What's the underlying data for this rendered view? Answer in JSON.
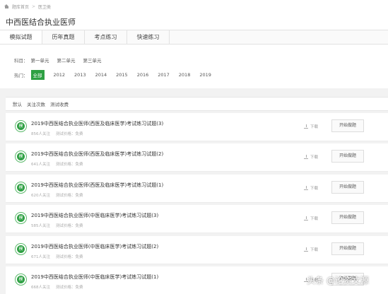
{
  "breadcrumb": {
    "home": "题库首页",
    "sep": ">",
    "current": "医卫类"
  },
  "page_title": "中西医结合执业医师",
  "tabs": [
    {
      "label": "模拟试题",
      "active": true
    },
    {
      "label": "历年真题",
      "active": false
    },
    {
      "label": "考点练习",
      "active": false
    },
    {
      "label": "快速练习",
      "active": false
    }
  ],
  "filters": {
    "subject_label": "科目：",
    "subjects": [
      "第一单元",
      "第二单元",
      "第三单元"
    ],
    "hot_label": "热门：",
    "hot": [
      "全部",
      "2012",
      "2013",
      "2014",
      "2015",
      "2016",
      "2017",
      "2018",
      "2019"
    ],
    "hot_selected": "全部"
  },
  "sort": [
    "默认",
    "关注次数",
    "测试收费"
  ],
  "items": [
    {
      "badge": "模",
      "title": "2019中西医结合执业医师(西医及临床医学)考试练习试题(3)",
      "followers": "856人关注",
      "price": "测试价格：免费",
      "download": "下载",
      "action": "开始做题"
    },
    {
      "badge": "模",
      "title": "2019中西医结合执业医师(西医及临床医学)考试练习试题(2)",
      "followers": "641人关注",
      "price": "测试价格：免费",
      "download": "下载",
      "action": "开始做题"
    },
    {
      "badge": "模",
      "title": "2019中西医结合执业医师(西医及临床医学)考试练习试题(1)",
      "followers": "620人关注",
      "price": "测试价格：免费",
      "download": "下载",
      "action": "开始做题"
    },
    {
      "badge": "模",
      "title": "2019中西医结合执业医师(中医临床医学)考试练习试题(3)",
      "followers": "585人关注",
      "price": "测试价格：免费",
      "download": "下载",
      "action": "开始做题"
    },
    {
      "badge": "模",
      "title": "2019中西医结合执业医师(中医临床医学)考试练习试题(2)",
      "followers": "671人关注",
      "price": "测试价格：免费",
      "download": "下载",
      "action": "开始做题"
    },
    {
      "badge": "模",
      "title": "2019中西医结合执业医师(中医临床医学)考试练习试题(1)",
      "followers": "668人关注",
      "price": "测试价格：免费",
      "download": "下载",
      "action": "开始做题"
    }
  ],
  "watermark": "头条 @论资文源",
  "colors": {
    "accent": "#2ea043",
    "badge_ring": "#5bb96b"
  }
}
